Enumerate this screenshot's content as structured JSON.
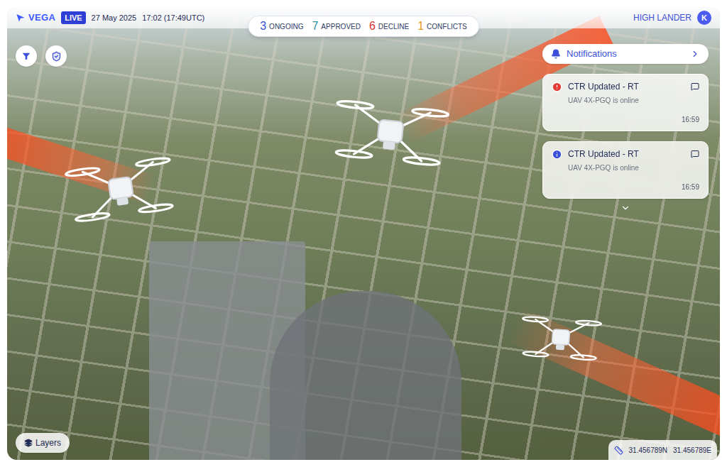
{
  "header": {
    "logo": "VEGA",
    "live": "LIVE",
    "date": "27 May 2025",
    "time": "17:02 (17:49UTC)",
    "user": "HIGH LANDER",
    "avatar": "K"
  },
  "stats": [
    {
      "count": "3",
      "label": "ONGOING",
      "color": "#3b4fd8"
    },
    {
      "count": "7",
      "label": "APPROVED",
      "color": "#2a8f9e"
    },
    {
      "count": "6",
      "label": "DECLINE",
      "color": "#d9342b"
    },
    {
      "count": "1",
      "label": "CONFLICTS",
      "color": "#e59a1c"
    }
  ],
  "notifications": {
    "title": "Notifications",
    "items": [
      {
        "kind": "alert",
        "color": "#e53935",
        "title": "CTR Updated - RT",
        "message": "UAV 4X-PGQ is online",
        "time": "16:59"
      },
      {
        "kind": "info",
        "color": "#3b4fd8",
        "title": "CTR Updated - RT",
        "message": "UAV 4X-PGQ is online",
        "time": "16:59"
      }
    ]
  },
  "layers": "Layers",
  "coordinates": {
    "lat": "31.456789N",
    "lon": "31.456789E"
  }
}
